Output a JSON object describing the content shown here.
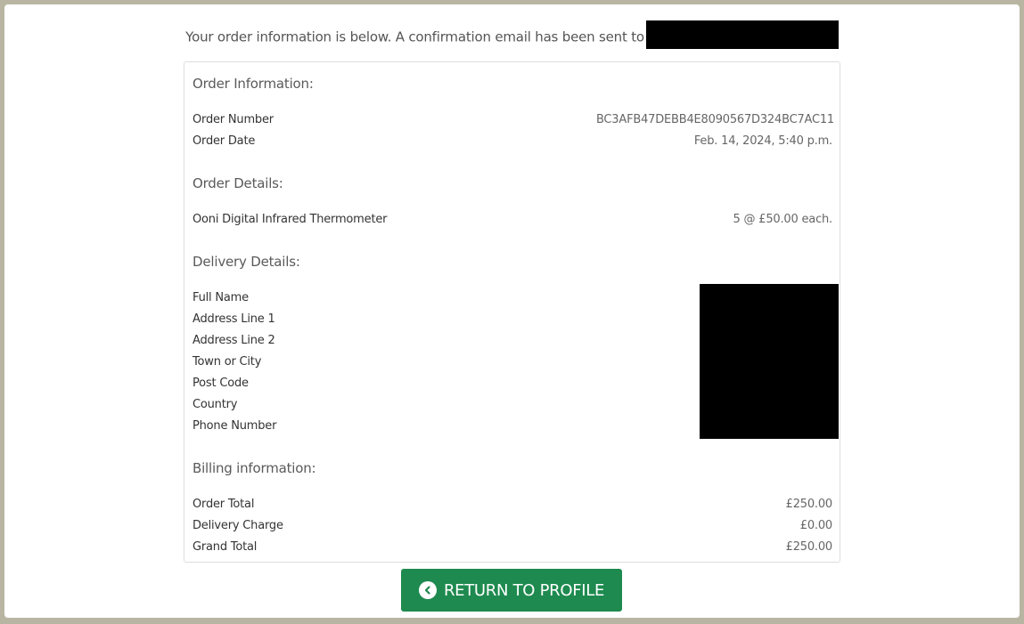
{
  "intro_text": "Your order information is below. A confirmation email has been sent to",
  "order_info": {
    "title": "Order Information:",
    "rows": [
      {
        "label": "Order Number",
        "value": "BC3AFB47DEBB4E8090567D324BC7AC11"
      },
      {
        "label": "Order Date",
        "value": "Feb. 14, 2024, 5:40 p.m."
      }
    ]
  },
  "order_details": {
    "title": "Order Details:",
    "rows": [
      {
        "label": "Ooni Digital Infrared Thermometer",
        "value": "5 @ £50.00 each."
      }
    ]
  },
  "delivery_details": {
    "title": "Delivery Details:",
    "rows": [
      {
        "label": "Full Name"
      },
      {
        "label": "Address Line 1"
      },
      {
        "label": "Address Line 2"
      },
      {
        "label": "Town or City"
      },
      {
        "label": "Post Code"
      },
      {
        "label": "Country"
      },
      {
        "label": "Phone Number"
      }
    ]
  },
  "billing": {
    "title": "Billing information:",
    "rows": [
      {
        "label": "Order Total",
        "value": "£250.00"
      },
      {
        "label": "Delivery Charge",
        "value": "£0.00"
      },
      {
        "label": "Grand Total",
        "value": "£250.00"
      }
    ]
  },
  "button": {
    "label": "RETURN TO PROFILE",
    "icon": "chevron-left-circle-icon",
    "color": "#1e8a4f"
  }
}
